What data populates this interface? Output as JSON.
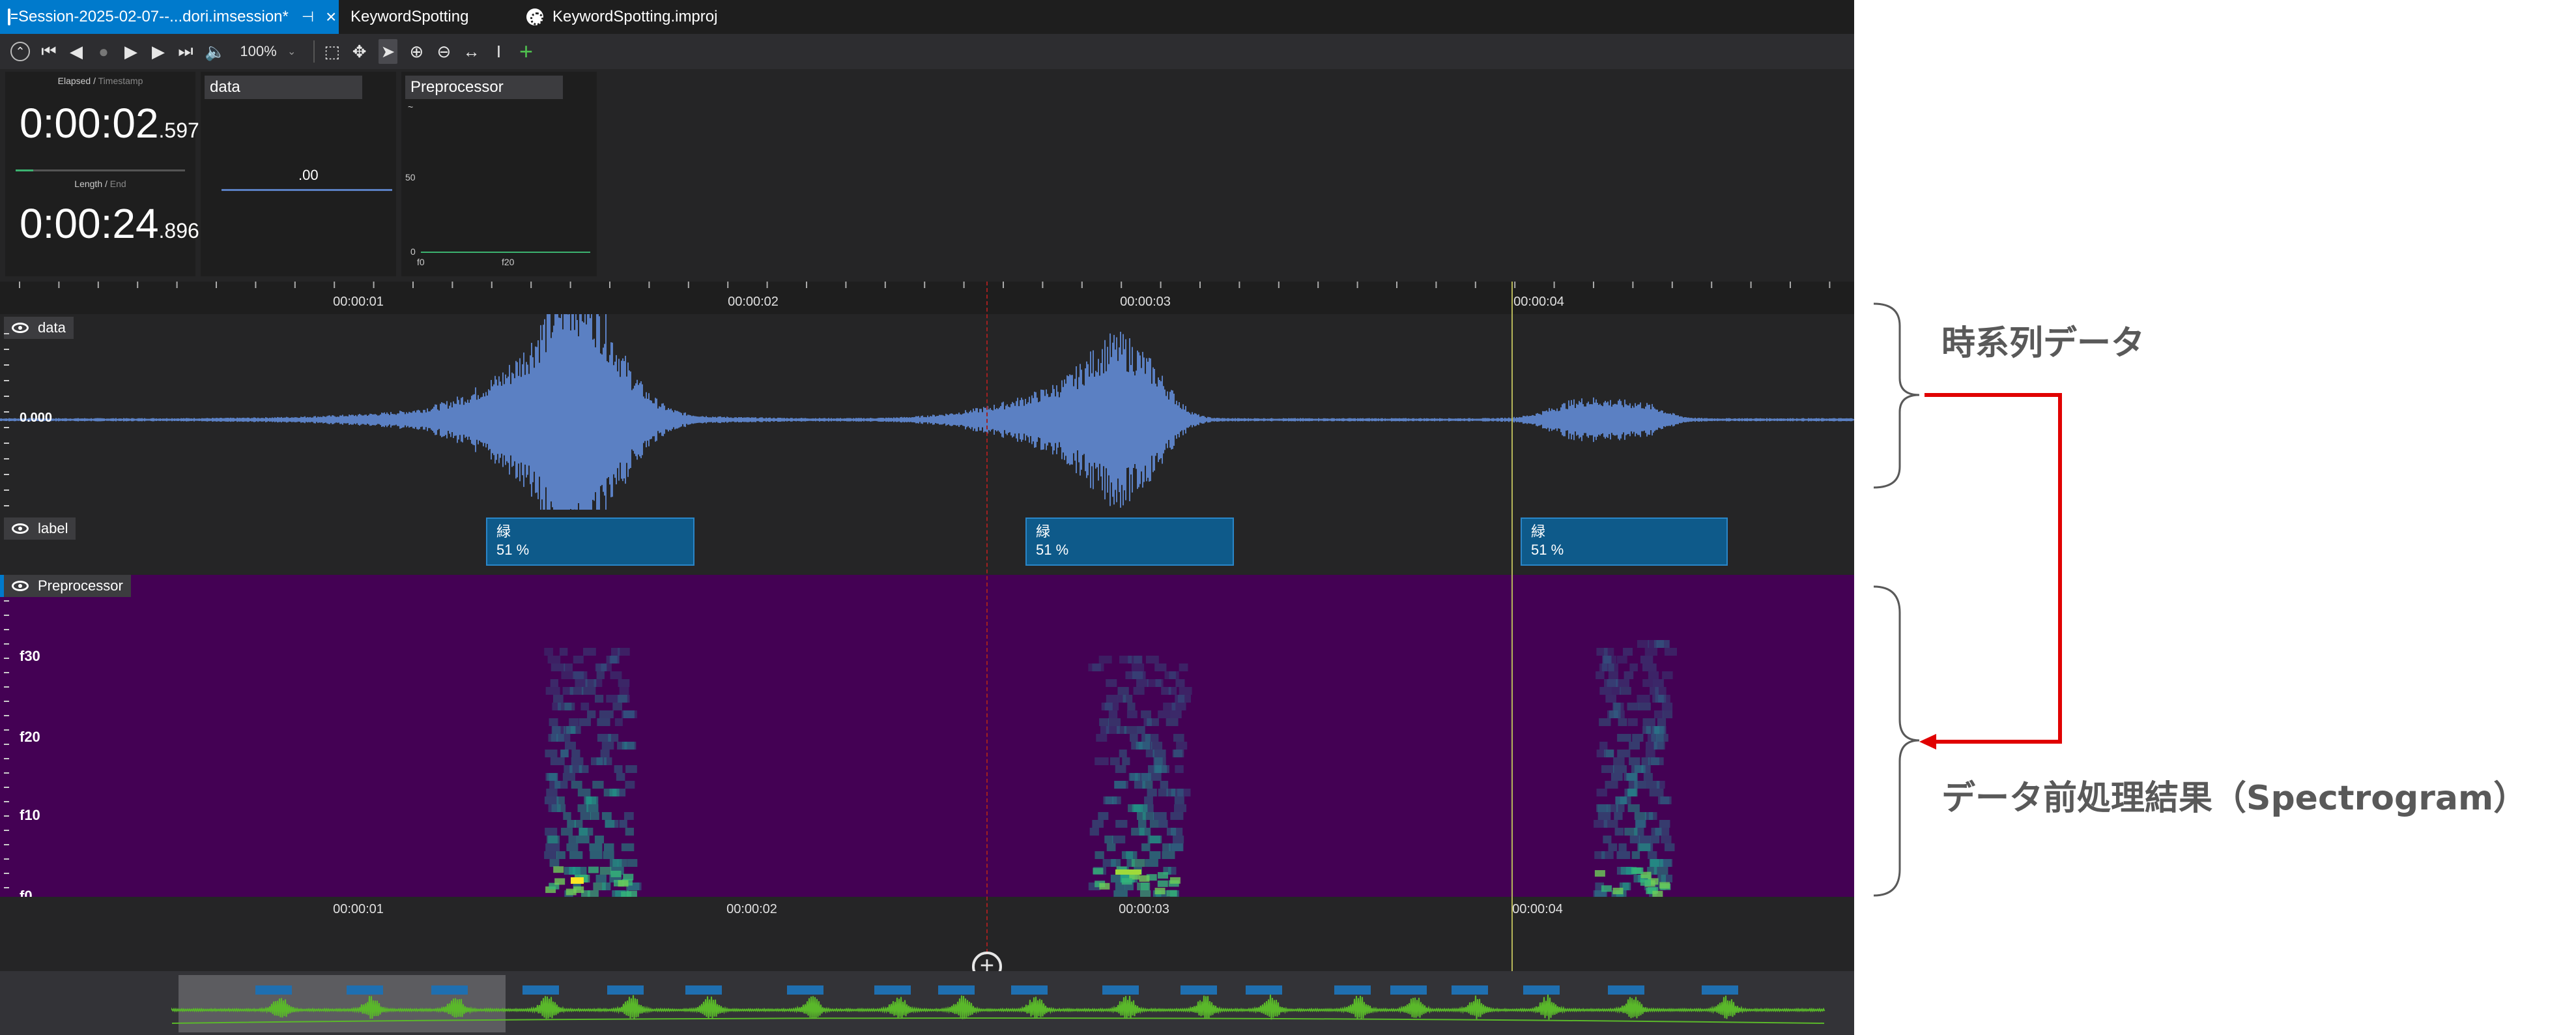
{
  "tabs": [
    {
      "label": "Session-2025-02-07--...dori.imsession*",
      "active": true
    },
    {
      "label": "KeywordSpotting",
      "active": false
    },
    {
      "label": "KeywordSpotting.improj",
      "active": false
    }
  ],
  "toolbar": {
    "zoom": "100%"
  },
  "time_panel": {
    "elapsed_label": "Elapsed",
    "timestamp_label": "Timestamp",
    "elapsed_main": "0:00:02",
    "elapsed_frac": ".597",
    "length_label": "Length",
    "end_label": "End",
    "length_main": "0:00:24",
    "length_frac": ".896",
    "progress": 0.104
  },
  "data_panel": {
    "title": "data",
    "value": ".00"
  },
  "pre_panel": {
    "title": "Preprocessor",
    "y_top": "~",
    "y_mid": "50",
    "y_bottom": "0",
    "x_left": "f0",
    "x_mid": "f20"
  },
  "ruler": {
    "ticks": [
      "00:00:01",
      "00:00:02",
      "00:00:03",
      "00:00:04"
    ]
  },
  "tracks": {
    "data": {
      "name": "data",
      "zero_label": "0.000"
    },
    "label": {
      "name": "label",
      "segments": [
        {
          "text": "緑",
          "conf": "51 %"
        },
        {
          "text": "緑",
          "conf": "51 %"
        },
        {
          "text": "緑",
          "conf": "51 %"
        }
      ]
    },
    "spec": {
      "name": "Preprocessor",
      "labels": [
        "f30",
        "f20",
        "f10",
        "f0"
      ]
    }
  },
  "colors": {
    "accent": "#007acc",
    "waveform": "#5b80c3",
    "segment": "#0e5a8a",
    "spectrogram_bg": "#440154",
    "cursor_red": "#c62828",
    "cursor_yellow": "#d4d470",
    "annotation_arrow": "#e00000"
  },
  "annotations": {
    "timeseries": "時系列データ",
    "preprocess": "データ前処理結果（Spectrogram）"
  }
}
